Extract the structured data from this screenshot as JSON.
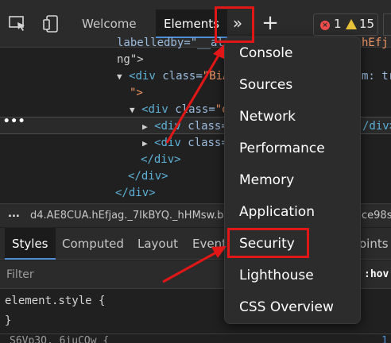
{
  "toolbar": {
    "inspect_icon": "inspect-icon",
    "device_icon": "device-toolbar-icon",
    "tabs": [
      {
        "label": "Welcome",
        "active": false
      },
      {
        "label": "Elements",
        "active": true
      }
    ],
    "more_tabs_glyph": "»",
    "add_tab_glyph": "+",
    "issues": {
      "errors": "1",
      "warnings": "15"
    }
  },
  "dom": {
    "lines": [
      {
        "text": "labelledby=\"__al",
        "trail": "hEfj"
      },
      {
        "text": "ng\">"
      },
      {
        "tag": "<div",
        "attr": "class=",
        "val": "\"BiA",
        "trail": "m: tr"
      },
      {
        "text": "\">"
      },
      {
        "tag": "<div",
        "attr": "class=",
        "val": "\"d"
      },
      {
        "tag": "<div",
        "attr": "class=",
        "trail": "/div>"
      },
      {
        "tag": "<div",
        "attr": "class="
      },
      {
        "text": "</div>"
      },
      {
        "text": "</div>"
      },
      {
        "text": "</div>"
      }
    ],
    "selected_dots": "•••"
  },
  "breadcrumb": {
    "dots": "...",
    "path": "d4.AE8CUA.hEfjag._7IkBYQ._hHMsw.b",
    "path_end": "ce98s"
  },
  "styles_tabs": [
    {
      "label": "Styles",
      "active": true
    },
    {
      "label": "Computed",
      "active": false
    },
    {
      "label": "Layout",
      "active": false
    },
    {
      "label": "Event",
      "active": false
    },
    {
      "label": "oints",
      "active": false
    }
  ],
  "filter": {
    "placeholder": "Filter",
    "hov": ":hov"
  },
  "rules": {
    "line1": "element.style {",
    "line2": "}",
    "next": "S6Vp3O._6iuCQw {",
    "next_num": "1"
  },
  "menu": {
    "items": [
      "Console",
      "Sources",
      "Network",
      "Performance",
      "Memory",
      "Application",
      "Security",
      "Lighthouse",
      "CSS Overview"
    ]
  },
  "annotation": {
    "color": "#e11717"
  }
}
